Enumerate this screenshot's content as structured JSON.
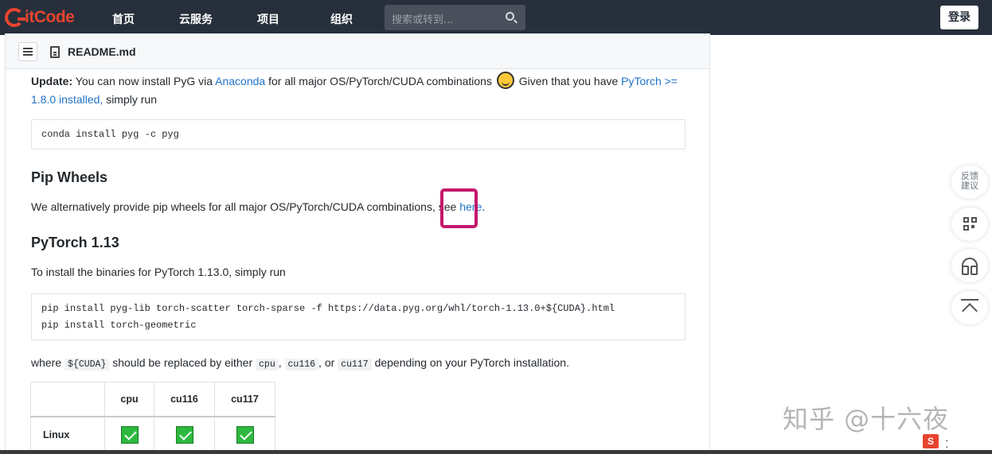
{
  "nav": {
    "logo": "itCode",
    "items": [
      "首页",
      "云服务",
      "项目",
      "组织"
    ],
    "search_placeholder": "搜索或转到...",
    "login": "登录"
  },
  "readme": {
    "file_name": "README.md",
    "update_label": "Update:",
    "update_text_1": "You can now install PyG via",
    "anaconda_link": "Anaconda",
    "update_text_2": "for all major OS/PyTorch/CUDA combinations",
    "update_text_3": "Given that you have",
    "pytorch_link": "PyTorch >= 1.8.0 installed,",
    "update_text_4": "simply run",
    "conda_cmd": "conda install pyg -c pyg",
    "pip_wheels_heading": "Pip Wheels",
    "pip_wheels_text": "We alternatively provide pip wheels for all major OS/PyTorch/CUDA combinations, see",
    "here_link": "here",
    "pytorch113_heading": "PyTorch 1.13",
    "pytorch113_text": "To install the binaries for PyTorch 1.13.0, simply run",
    "pip_cmd_1": "pip install pyg-lib torch-scatter torch-sparse -f https://data.pyg.org/whl/torch-1.13.0+${CUDA}.html",
    "pip_cmd_2": "pip install torch-geometric",
    "where_text_1": "where",
    "cuda_var": "${CUDA}",
    "where_text_2": "should be replaced by either",
    "opt_cpu": "cpu",
    "opt_cu116": "cu116",
    "opt_cu117": "cu117",
    "where_text_3": "depending on your PyTorch installation.",
    "table": {
      "headers": [
        "",
        "cpu",
        "cu116",
        "cu117"
      ],
      "rows": [
        {
          "label": "Linux",
          "cpu": true,
          "cu116": true,
          "cu117": true
        }
      ]
    }
  },
  "sidebar_right": {
    "feedback_1": "反馈",
    "feedback_2": "建议"
  },
  "watermark": "知乎 @十六夜",
  "colors": {
    "topbar": "#262f3b",
    "brand": "#e8442f",
    "link": "#1f73c7",
    "highlight": "#c4186b",
    "check": "#2eb83f"
  }
}
